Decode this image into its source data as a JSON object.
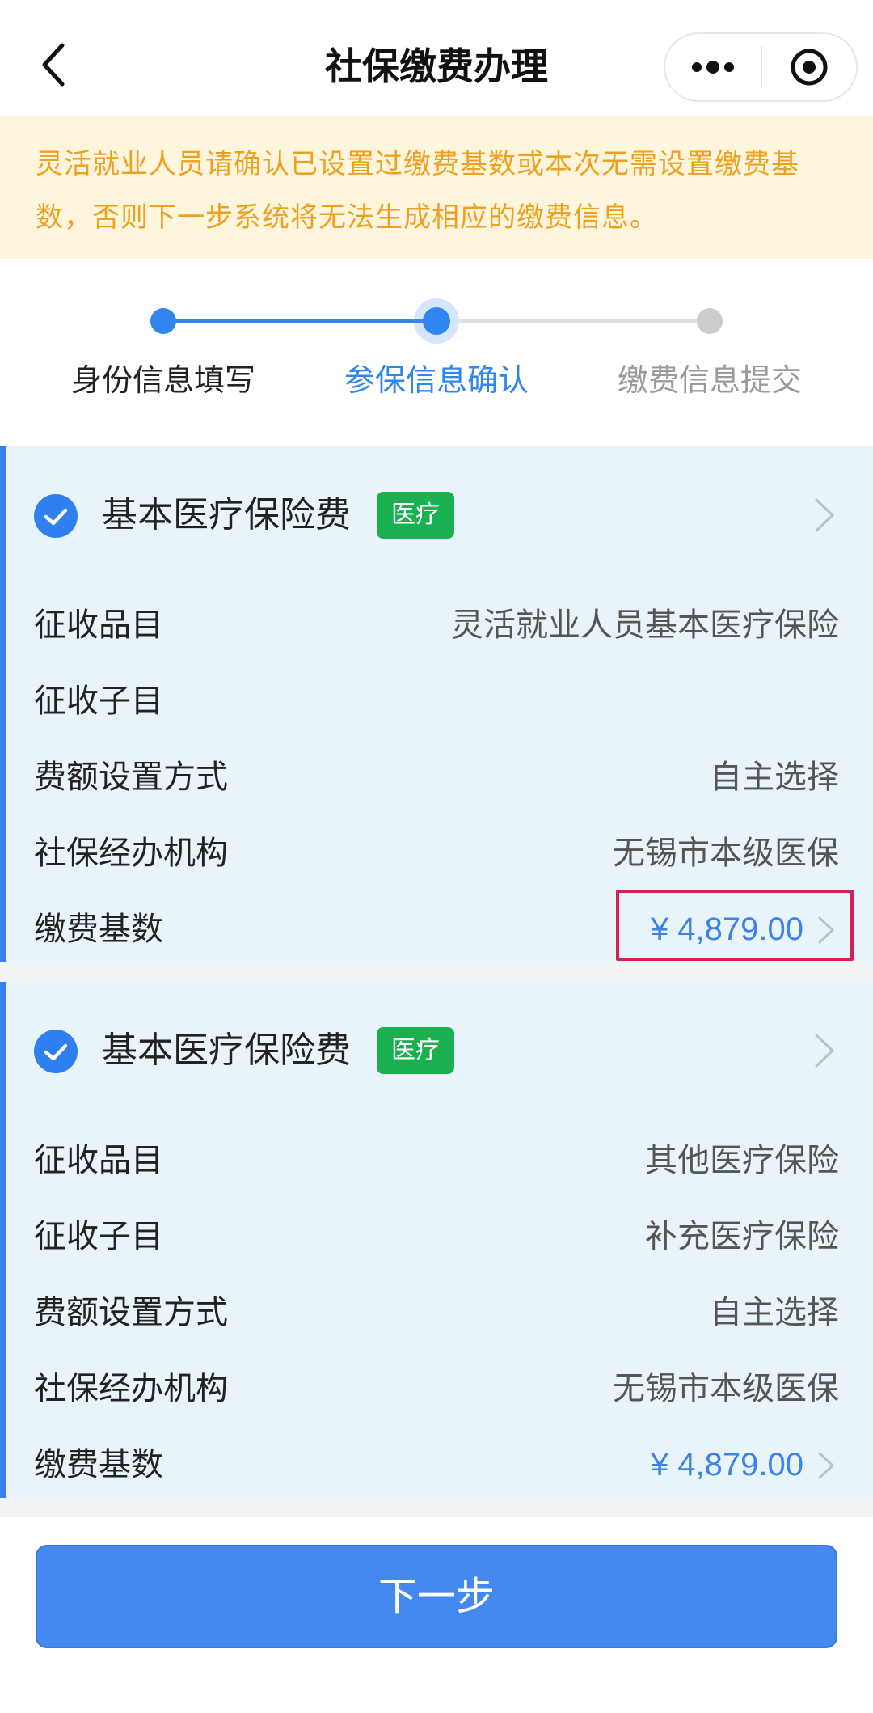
{
  "header": {
    "title": "社保缴费办理",
    "back_icon": "chevron-left-icon",
    "more_icon": "more-dots-icon",
    "close_icon": "target-circle-icon"
  },
  "notice": {
    "text": "灵活就业人员请确认已设置过缴费基数或本次无需设置缴费基数，否则下一步系统将无法生成相应的缴费信息。",
    "color": "#f0a020",
    "background": "#fdf6dc"
  },
  "steps": [
    {
      "label": "身份信息填写",
      "state": "done"
    },
    {
      "label": "参保信息确认",
      "state": "current"
    },
    {
      "label": "缴费信息提交",
      "state": "pending"
    }
  ],
  "cards": [
    {
      "title": "基本医疗保险费",
      "tag": "医疗",
      "checked": true,
      "rows": [
        {
          "label": "征收品目",
          "value": "灵活就业人员基本医疗保险"
        },
        {
          "label": "征收子目",
          "value": ""
        },
        {
          "label": "费额设置方式",
          "value": "自主选择"
        },
        {
          "label": "社保经办机构",
          "value": "无锡市本级医保"
        },
        {
          "label": "缴费基数",
          "value": "¥ 4,879.00"
        }
      ]
    },
    {
      "title": "基本医疗保险费",
      "tag": "医疗",
      "checked": true,
      "rows": [
        {
          "label": "征收品目",
          "value": "其他医疗保险"
        },
        {
          "label": "征收子目",
          "value": "补充医疗保险"
        },
        {
          "label": "费额设置方式",
          "value": "自主选择"
        },
        {
          "label": "社保经办机构",
          "value": "无锡市本级医保"
        },
        {
          "label": "缴费基数",
          "value": "¥ 4,879.00"
        }
      ]
    }
  ],
  "next_button": {
    "label": "下一步"
  },
  "colors": {
    "accent": "#3a7ff0",
    "step_active": "#2f86ee",
    "tag_green": "#1ab04f",
    "amount_blue": "#3d84ea",
    "highlight_red": "#d8214e"
  }
}
